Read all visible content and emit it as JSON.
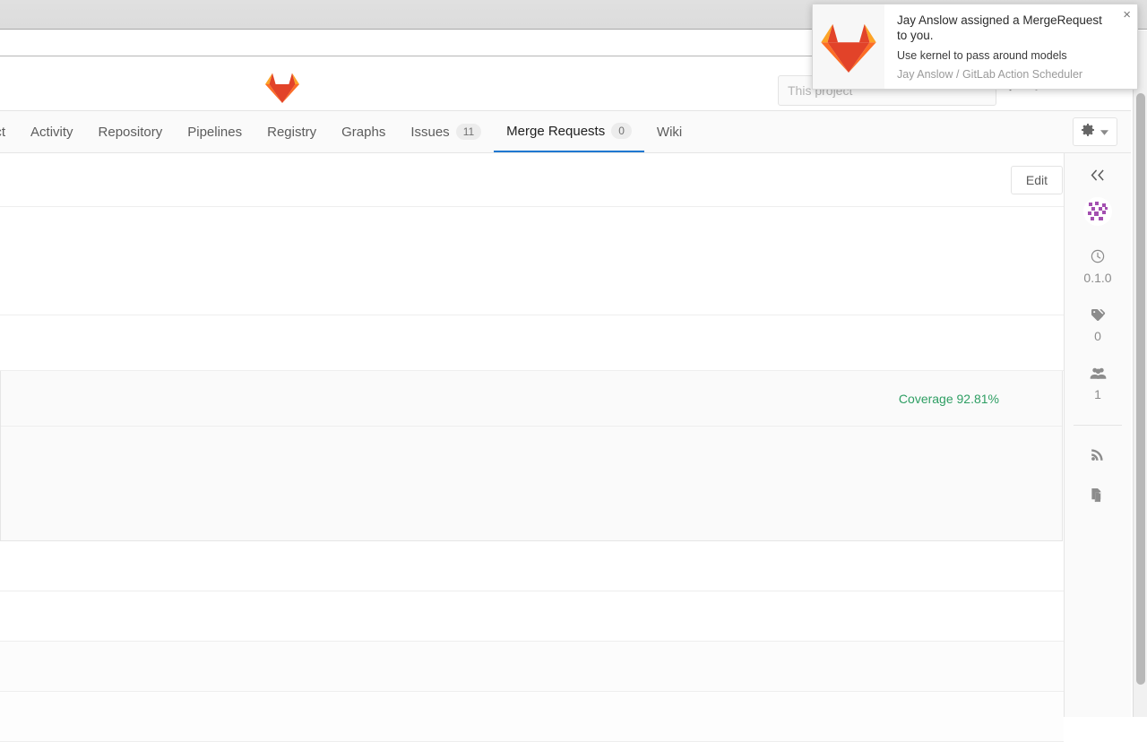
{
  "browser": {
    "chrome_label": "",
    "toolbar_label": ""
  },
  "header": {
    "logo_name": "gitlab-fox-logo",
    "search": {
      "value": "",
      "placeholder": "This project"
    },
    "icons": [
      "plus-icon",
      "todos-icon",
      "user-avatar"
    ]
  },
  "nav": {
    "tabs": [
      {
        "label": "ect",
        "badge": null,
        "active": false,
        "name": "tab-project"
      },
      {
        "label": "Activity",
        "badge": null,
        "active": false,
        "name": "tab-activity"
      },
      {
        "label": "Repository",
        "badge": null,
        "active": false,
        "name": "tab-repository"
      },
      {
        "label": "Pipelines",
        "badge": null,
        "active": false,
        "name": "tab-pipelines"
      },
      {
        "label": "Registry",
        "badge": null,
        "active": false,
        "name": "tab-registry"
      },
      {
        "label": "Graphs",
        "badge": null,
        "active": false,
        "name": "tab-graphs"
      },
      {
        "label": "Issues",
        "badge": "11",
        "active": false,
        "name": "tab-issues"
      },
      {
        "label": "Merge Requests",
        "badge": "0",
        "active": true,
        "name": "tab-merge-requests"
      },
      {
        "label": "Wiki",
        "badge": null,
        "active": false,
        "name": "tab-wiki"
      }
    ],
    "settings_icon": "gear-icon",
    "settings_caret": "chevron-down-icon"
  },
  "content": {
    "edit_label": "Edit",
    "coverage_label": "Coverage 92.81%",
    "coverage_color": "#2e9e63"
  },
  "sidebar": {
    "collapse_icon": "chevron-double-left-icon",
    "avatar_name": "identicon-avatar",
    "items": [
      {
        "icon": "clock-icon",
        "value": "0.1.0",
        "name": "sidebar-milestone"
      },
      {
        "icon": "tag-icon",
        "value": "0",
        "name": "sidebar-labels"
      },
      {
        "icon": "users-icon",
        "value": "1",
        "name": "sidebar-participants"
      }
    ],
    "plain_items": [
      {
        "icon": "rss-icon",
        "name": "sidebar-subscribe"
      },
      {
        "icon": "copy-icon",
        "name": "sidebar-copy-reference"
      }
    ]
  },
  "notification": {
    "title": "Jay Anslow assigned a MergeRequest to you.",
    "subtitle": "Use kernel to pass around models",
    "meta": "Jay Anslow / GitLab Action Scheduler",
    "close_label": "×",
    "icon_name": "gitlab-fox-logo"
  }
}
